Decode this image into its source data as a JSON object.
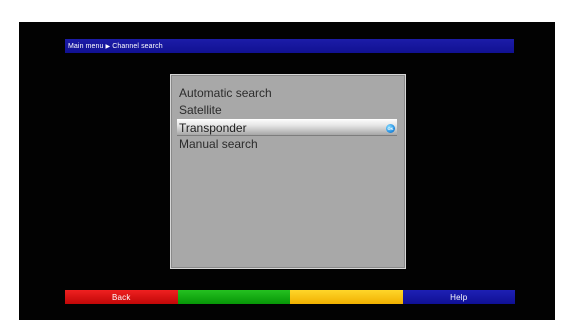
{
  "header": {
    "breadcrumb": {
      "parent": "Main menu",
      "separator": "▶",
      "current": "Channel search"
    }
  },
  "menu": {
    "items": [
      {
        "label": "Automatic search"
      },
      {
        "label": "Satellite"
      },
      {
        "label": "Transponder",
        "selected": true,
        "trailing_icon": "ok-button-icon"
      },
      {
        "label": "Manual search"
      }
    ]
  },
  "function_keys": {
    "red": {
      "label": "Back",
      "color": "#d51212"
    },
    "green": {
      "label": "",
      "color": "#109f10"
    },
    "yellow": {
      "label": "",
      "color": "#f5c000"
    },
    "blue": {
      "label": "Help",
      "color": "#1717a0"
    }
  },
  "colors": {
    "screen_background": "#020202",
    "menu_background": "#a8a8a8",
    "accent_blue": "#1616a0"
  }
}
